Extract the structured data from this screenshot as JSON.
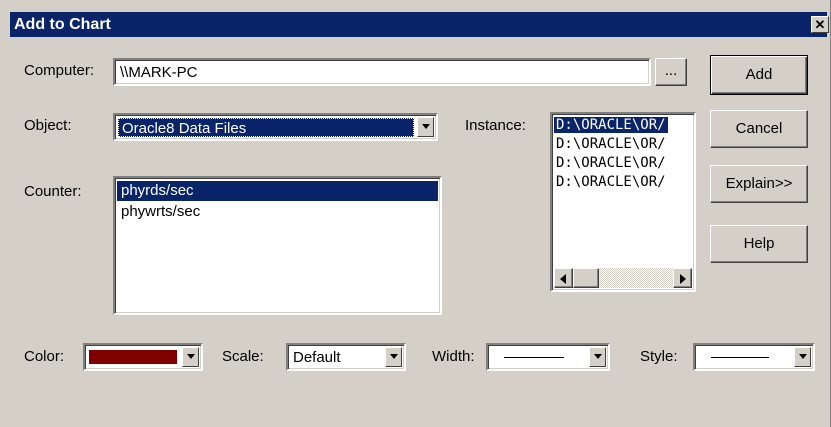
{
  "dialog": {
    "title": "Add to Chart",
    "close_glyph": "✕"
  },
  "computer": {
    "label": "Computer:",
    "value": "\\\\MARK-PC",
    "browse_label": "..."
  },
  "object": {
    "label": "Object:",
    "selected": "Oracle8 Data Files"
  },
  "counter": {
    "label": "Counter:",
    "items": [
      "phyrds/sec",
      "phywrts/sec"
    ],
    "selected_index": 0
  },
  "instance": {
    "label": "Instance:",
    "items": [
      "D:\\ORACLE\\OR/",
      "D:\\ORACLE\\OR/",
      "D:\\ORACLE\\OR/",
      "D:\\ORACLE\\OR/"
    ],
    "selected_index": 0
  },
  "buttons": {
    "add": "Add",
    "cancel": "Cancel",
    "explain": "Explain>>",
    "help": "Help"
  },
  "color": {
    "label": "Color:",
    "value_hex": "#800000"
  },
  "scale": {
    "label": "Scale:",
    "selected": "Default"
  },
  "width": {
    "label": "Width:"
  },
  "style": {
    "label": "Style:"
  },
  "colors": {
    "title_bar": "#0a246a",
    "face": "#d4d0c8",
    "selection": "#0a246a"
  }
}
